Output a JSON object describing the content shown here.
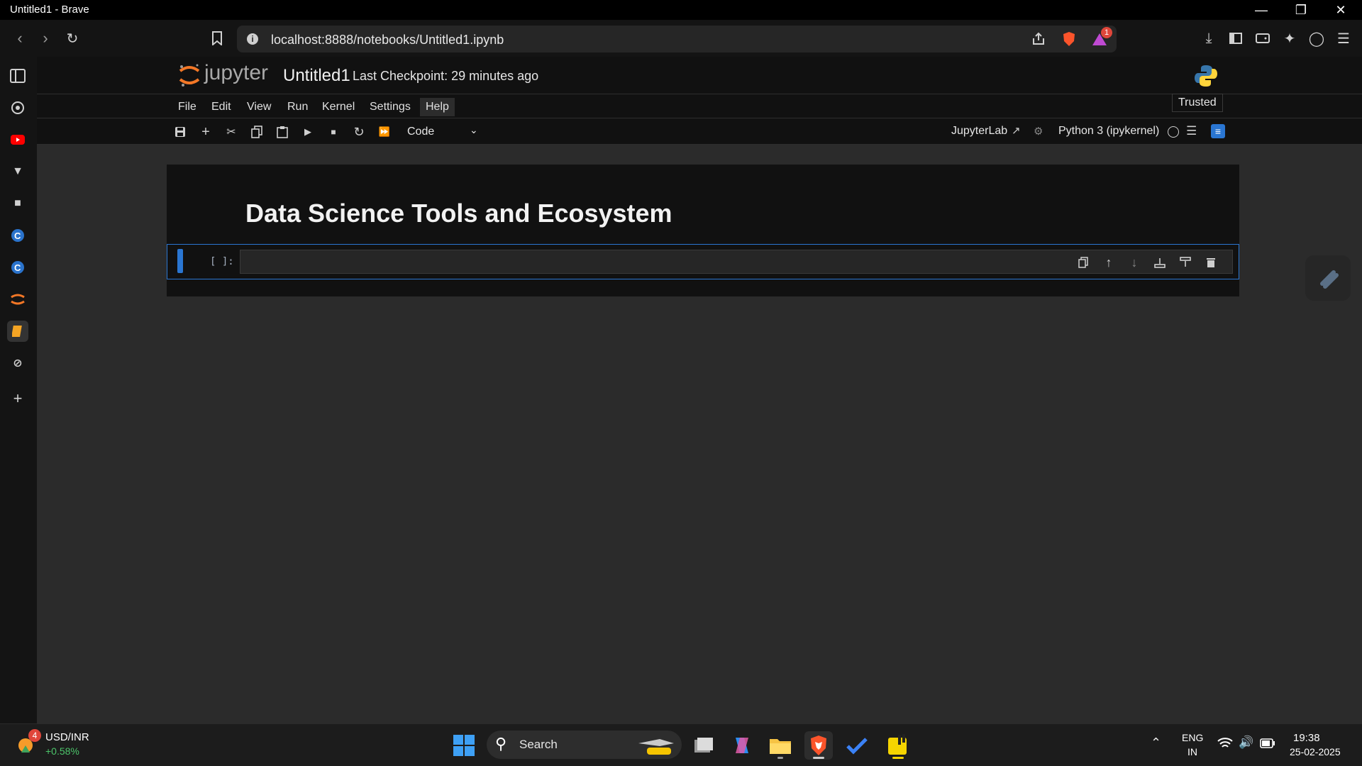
{
  "window": {
    "title": "Untitled1 - Brave"
  },
  "browser": {
    "url": "localhost:8888/notebooks/Untitled1.ipynb",
    "info_symbol": "i",
    "alerts_badge": "1"
  },
  "jupyter": {
    "logo_text": "jupyter",
    "notebook_name": "Untitled1",
    "checkpoint": "Last Checkpoint: 29 minutes ago",
    "trusted_label": "Trusted",
    "menu": [
      "File",
      "Edit",
      "View",
      "Run",
      "Kernel",
      "Settings",
      "Help"
    ],
    "cell_type": "Code",
    "jupyterlab_label": "JupyterLab",
    "kernel_name": "Python 3 (ipykernel)",
    "heading": "Data Science Tools and Ecosystem",
    "prompt": "[ ]:"
  },
  "taskbar": {
    "widget_badge": "4",
    "ticker": "USD/INR",
    "ticker_change": "+0.58%",
    "search_label": "Search",
    "lang": "ENG",
    "region": "IN",
    "time": "19:38",
    "date": "25-02-2025"
  },
  "colors": {
    "accent": "#2a76d2",
    "jupyter_orange": "#f37726",
    "ticker_green": "#4cc46a"
  }
}
